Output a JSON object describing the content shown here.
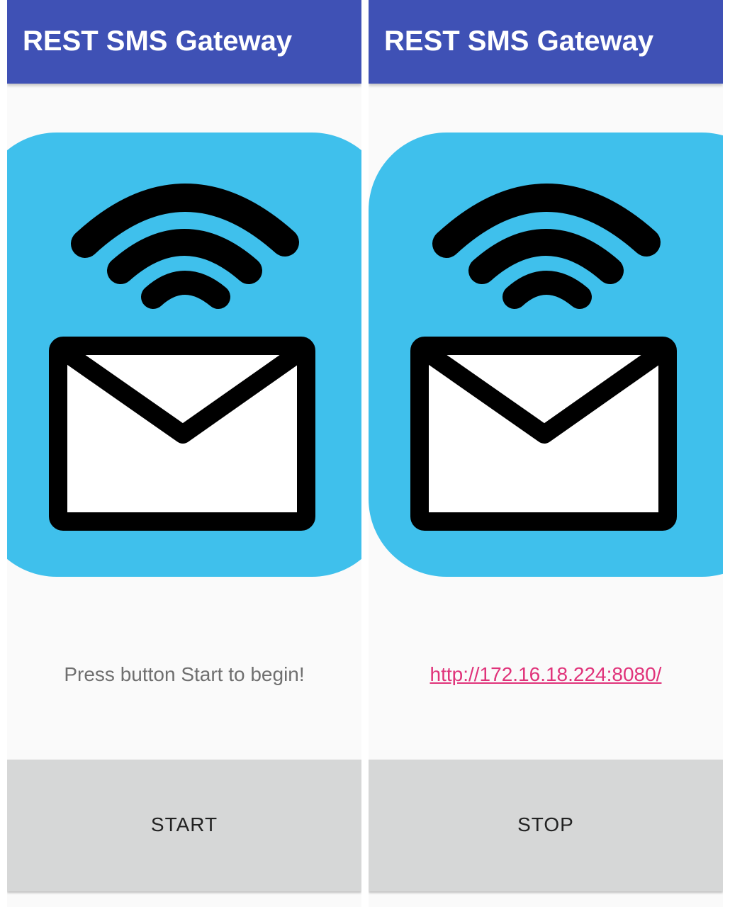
{
  "colors": {
    "app_bar": "#3f51b5",
    "logo_background": "#3fc0ec",
    "button_background": "#d6d7d7",
    "link": "#e0337a"
  },
  "screens": [
    {
      "app_bar": {
        "title": "REST SMS Gateway"
      },
      "logo": {
        "icon": "wifi-envelope-icon"
      },
      "status": {
        "text": "Press button Start to begin!"
      },
      "button": {
        "label": "START"
      }
    },
    {
      "app_bar": {
        "title": "REST SMS Gateway"
      },
      "logo": {
        "icon": "wifi-envelope-icon"
      },
      "status": {
        "link": "http://172.16.18.224:8080/"
      },
      "button": {
        "label": "STOP"
      }
    }
  ]
}
